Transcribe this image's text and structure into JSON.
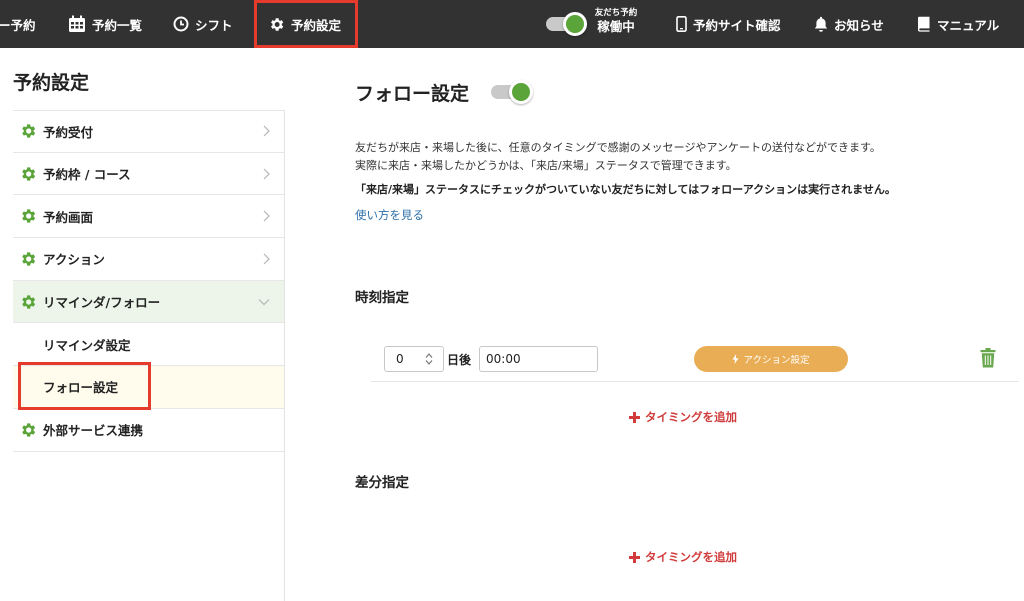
{
  "nav": {
    "items": [
      {
        "label": "ー予約"
      },
      {
        "label": "予約一覧",
        "icon": "calendar-icon"
      },
      {
        "label": "シフト",
        "icon": "clock-icon"
      },
      {
        "label": "予約設定",
        "icon": "gear-icon"
      }
    ],
    "status_toggle": {
      "line1": "友だち予約",
      "line2": "稼働中"
    },
    "right_items": [
      {
        "label": "予約サイト確認",
        "icon": "phone-icon"
      },
      {
        "label": "お知らせ",
        "icon": "bell-icon"
      },
      {
        "label": "マニュアル",
        "icon": "book-icon"
      }
    ]
  },
  "sidebar": {
    "title": "予約設定",
    "items": [
      {
        "label": "予約受付"
      },
      {
        "label": "予約枠 / コース"
      },
      {
        "label": "予約画面"
      },
      {
        "label": "アクション"
      },
      {
        "label": "リマインダ/フォロー"
      },
      {
        "label": "リマインダ設定"
      },
      {
        "label": "フォロー設定"
      },
      {
        "label": "外部サービス連携"
      }
    ]
  },
  "main": {
    "title": "フォロー設定",
    "description": {
      "line1": "友だちが来店・来場した後に、任意のタイミングで感謝のメッセージやアンケートの送付などができます。",
      "line2": "実際に来店・来場したかどうかは、「来店/来場」ステータスで管理できます。",
      "line3": "「来店/来場」ステータスにチェックがついていない友だちに対してはフォローアクションは実行されません。"
    },
    "help_link": "使い方を見る",
    "section_time": {
      "title": "時刻指定",
      "row": {
        "days_value": "0",
        "days_label": "日後",
        "time_value": "00:00",
        "action_label": "アクション設定"
      },
      "add_label": "タイミングを追加"
    },
    "section_diff": {
      "title": "差分指定",
      "add_label": "タイミングを追加"
    }
  },
  "colors": {
    "topbar": "#323232",
    "accent_green": "#5aa43a",
    "action_orange": "#e9ad55",
    "add_red": "#d03b3b",
    "highlight_red": "#e53b2c"
  }
}
